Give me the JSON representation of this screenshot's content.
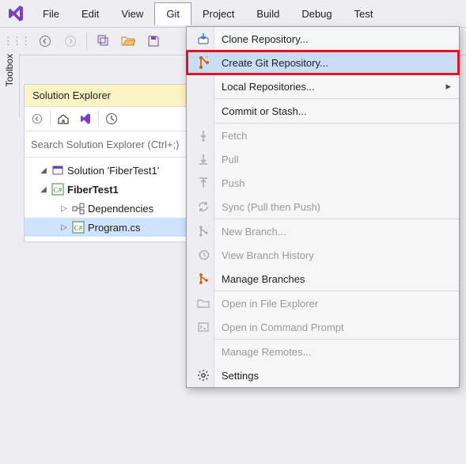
{
  "menubar": {
    "file": "File",
    "edit": "Edit",
    "view": "View",
    "git": "Git",
    "project": "Project",
    "build": "Build",
    "debug": "Debug",
    "test": "Test"
  },
  "sidebar": {
    "toolbox": "Toolbox"
  },
  "solution_explorer": {
    "title": "Solution Explorer",
    "search_placeholder": "Search Solution Explorer (Ctrl+;)",
    "solution_label": "Solution 'FiberTest1'",
    "project_label": "FiberTest1",
    "dependencies_label": "Dependencies",
    "file_label": "Program.cs"
  },
  "git_menu": {
    "clone": "Clone Repository...",
    "create": "Create Git Repository...",
    "local_repos": "Local Repositories...",
    "commit_stash": "Commit or Stash...",
    "fetch": "Fetch",
    "pull": "Pull",
    "push": "Push",
    "sync": "Sync (Pull then Push)",
    "new_branch": "New Branch...",
    "view_history": "View Branch History",
    "manage_branches": "Manage Branches",
    "open_explorer": "Open in File Explorer",
    "open_cmd": "Open in Command Prompt",
    "manage_remotes": "Manage Remotes...",
    "settings": "Settings"
  }
}
